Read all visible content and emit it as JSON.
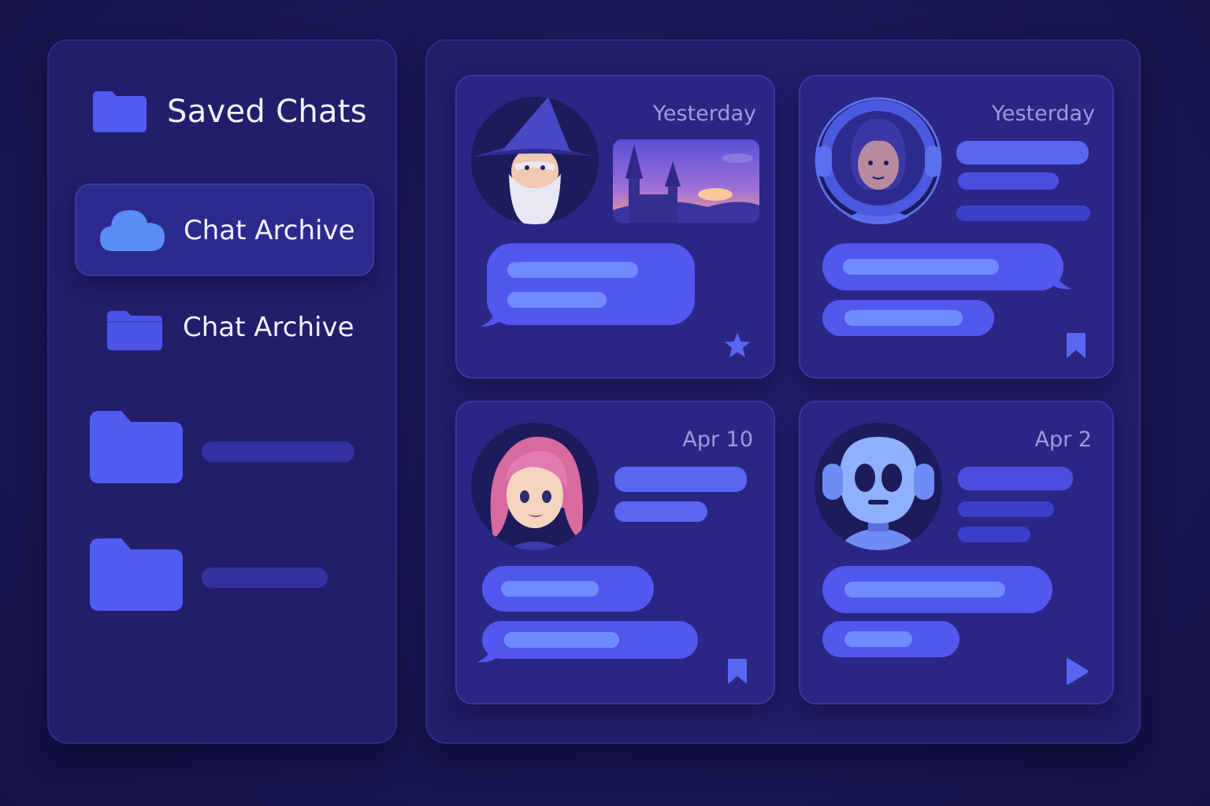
{
  "sidebar": {
    "title": "Saved Chats",
    "items": [
      {
        "label": "Chat Archive",
        "icon": "cloud-icon",
        "active": true
      },
      {
        "label": "Chat Archive",
        "icon": "folder-icon",
        "active": false
      },
      {
        "label": "",
        "icon": "folder-icon",
        "active": false
      },
      {
        "label": "",
        "icon": "folder-icon",
        "active": false
      }
    ]
  },
  "cards": [
    {
      "date": "Yesterday",
      "avatar": "wizard-avatar",
      "action_icon": "star-icon"
    },
    {
      "date": "Yesterday",
      "avatar": "astronaut-avatar",
      "action_icon": "bookmark-icon"
    },
    {
      "date": "Apr 10",
      "avatar": "girl-avatar",
      "action_icon": "bookmark-icon"
    },
    {
      "date": "Apr 2",
      "avatar": "robot-avatar",
      "action_icon": "play-icon"
    }
  ],
  "colors": {
    "background": "#181654",
    "panel": "#221e6c",
    "card": "#2a2685",
    "accent": "#5157ef",
    "text": "#f2f1ff",
    "muted_text": "#9d9ae0"
  }
}
